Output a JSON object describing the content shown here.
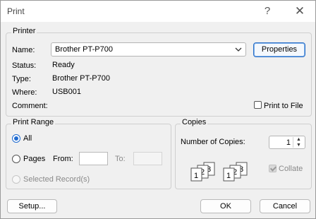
{
  "window": {
    "title": "Print",
    "help": "?",
    "close": "✕"
  },
  "printer": {
    "group_label": "Printer",
    "name_label": "Name:",
    "name_value": "Brother PT-P700",
    "properties_label": "Properties",
    "status_label": "Status:",
    "status_value": "Ready",
    "type_label": "Type:",
    "type_value": "Brother PT-P700",
    "where_label": "Where:",
    "where_value": "USB001",
    "comment_label": "Comment:",
    "print_to_file_label": "Print to File"
  },
  "range": {
    "group_label": "Print Range",
    "all_label": "All",
    "pages_label": "Pages",
    "from_label": "From:",
    "to_label": "To:",
    "selected_label": "Selected Record(s)"
  },
  "copies": {
    "group_label": "Copies",
    "number_label": "Number of Copies:",
    "number_value": "1",
    "collate_label": "Collate",
    "icon_numbers": [
      "1",
      "2",
      "3"
    ]
  },
  "footer": {
    "setup_label": "Setup...",
    "ok_label": "OK",
    "cancel_label": "Cancel"
  },
  "colors": {
    "accent": "#1f6bd0",
    "border": "#b9b9b9"
  }
}
